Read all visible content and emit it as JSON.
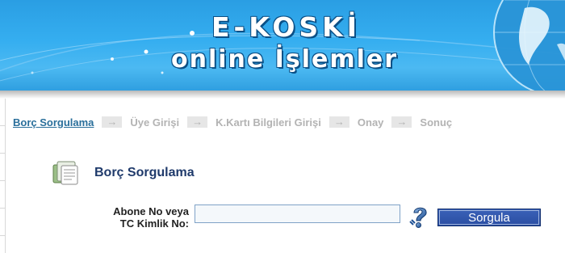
{
  "banner": {
    "title": "E-KOSKİ",
    "subtitle": "online İşlemler"
  },
  "steps": [
    {
      "label": "Borç Sorgulama",
      "active": true
    },
    {
      "label": "Üye Girişi",
      "active": false
    },
    {
      "label": "K.Kartı Bilgileri Girişi",
      "active": false
    },
    {
      "label": "Onay",
      "active": false
    },
    {
      "label": "Sonuç",
      "active": false
    }
  ],
  "step_arrow": "→",
  "section": {
    "title": "Borç Sorgulama",
    "icon": "document-stack-icon"
  },
  "form": {
    "label_line1": "Abone No veya",
    "label_line2": "TC Kimlik No:",
    "input_value": "",
    "help_icon": "question-mark-icon",
    "submit_label": "Sorgula"
  },
  "colors": {
    "banner_blue": "#35aef0",
    "active_step": "#2a6f9b",
    "inactive_step": "#b3b3b3",
    "heading": "#1f3a6b",
    "button": "#2f55a8"
  }
}
